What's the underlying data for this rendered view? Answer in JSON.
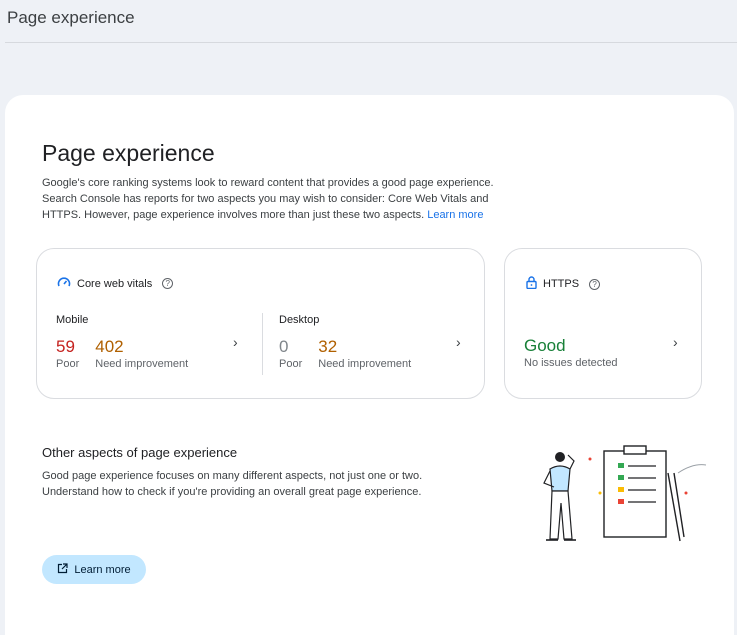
{
  "topbar": {
    "title": "Page experience"
  },
  "main": {
    "heading": "Page experience",
    "intro": "Google's core ranking systems look to reward content that provides a good page experience. Search Console has reports for two aspects you may wish to consider: Core Web Vitals and HTTPS. However, page experience involves more than just these two aspects.",
    "intro_link": "Learn more"
  },
  "core_web_vitals": {
    "title": "Core web vitals",
    "help": "?",
    "mobile": {
      "label": "Mobile",
      "poor_value": "59",
      "poor_label": "Poor",
      "ni_value": "402",
      "ni_label": "Need improvement"
    },
    "desktop": {
      "label": "Desktop",
      "poor_value": "0",
      "poor_label": "Poor",
      "ni_value": "32",
      "ni_label": "Need improvement"
    }
  },
  "https": {
    "title": "HTTPS",
    "help": "?",
    "status": "Good",
    "detail": "No issues detected"
  },
  "other": {
    "title": "Other aspects of page experience",
    "text": "Good page experience focuses on many different aspects, not just one or two. Understand how to check if you're providing an overall great page experience.",
    "button": "Learn more"
  },
  "colors": {
    "poor": "#c5221f",
    "need_improvement": "#b06000",
    "good": "#188038",
    "link": "#1a73e8",
    "button_bg": "#c2e7ff"
  },
  "icons": [
    "gauge-icon",
    "help-icon",
    "lock-icon",
    "chevron-right-icon",
    "open-in-new-icon",
    "checklist-illustration"
  ]
}
